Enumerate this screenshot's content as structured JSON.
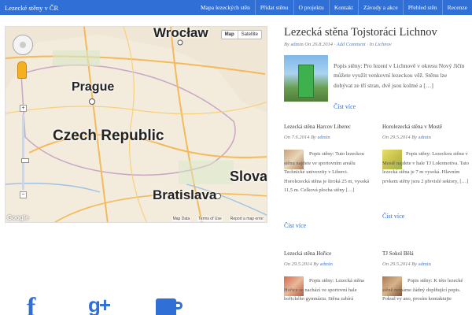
{
  "site": {
    "brand": "Lezecké stěny v ČR"
  },
  "nav": {
    "items": [
      {
        "label": "Mapa lezeckých stěn"
      },
      {
        "label": "Přidat stěnu"
      },
      {
        "label": "O projektu"
      },
      {
        "label": "Kontakt"
      },
      {
        "label": "Závody a akce"
      },
      {
        "label": "Přehled stěn"
      },
      {
        "label": "Recenze"
      }
    ]
  },
  "map": {
    "type_map": "Map",
    "type_satellite": "Satellite",
    "zoom_in": "+",
    "zoom_out": "−",
    "logo": "Google",
    "footer_links": [
      "Map Data",
      "Terms of Use",
      "Report a map error"
    ],
    "cities": {
      "wroclaw": "Wrocław",
      "prague": "Prague",
      "country": "Czech Republic",
      "slova": "Slova",
      "bratislava": "Bratislava"
    }
  },
  "social": {
    "facebook": "f",
    "googleplus": "g+",
    "blog": "mug-icon"
  },
  "featured": {
    "title": "Lezecká stěna Tojstoráci Lichnov",
    "by": "By",
    "author": "admin",
    "on": "On",
    "date": "26.8.2014",
    "sep": "·",
    "comment": "Add Comment",
    "in": "· In",
    "category": "Lichnov",
    "excerpt": "Popis stěny: Pro lezení v Lichnově v okresu Nový Jičín můžete využít venkovní lezeckou věž. Stěnu lze dobývat ze tří stran, dvě jsou kolmé a […]",
    "read_more": "Číst více"
  },
  "posts": [
    {
      "title": "Lezecká stěna Harcov Liberec",
      "on": "On",
      "date": "7.6.2014",
      "by": "By",
      "author": "admin",
      "excerpt": "Popis stěny: Tuto lezeckou stěnu najdete ve sportovním areálu Technické univerzity v Liberci. Horolezecká stěna je široká 25 m, vysoká 11,5 m. Celková plocha stěny […]",
      "read_more": "Číst více"
    },
    {
      "title": "Horolezecká stěna v Mostě",
      "on": "On",
      "date": "29.5.2014",
      "by": "By",
      "author": "admin",
      "excerpt": "Popis stěny: Lezeckou stěnu v Mostě najdete v hale TJ Lokomotiva. Tato lezecká stěna je 7 m vysoká. Hlavním prvkem stěny jsou 2 převislé sektory, […]",
      "read_more": "Číst více"
    },
    {
      "title": "Lezecká stěna Hořice",
      "on": "On",
      "date": "29.5.2014",
      "by": "By",
      "author": "admin",
      "excerpt": "Popis stěny: Lezecká stěna Hořice se nachází ve sportovní hale hořického gymnázia. Stěna zabírá"
    },
    {
      "title": "TJ Sokol Bělá",
      "on": "On",
      "date": "29.5.2014",
      "by": "By",
      "author": "admin",
      "excerpt": "Popis stěny: K této lezecké stěně nemáme žádný doplňující popis. Pokud vy ano, prosím kontaktujte"
    }
  ]
}
